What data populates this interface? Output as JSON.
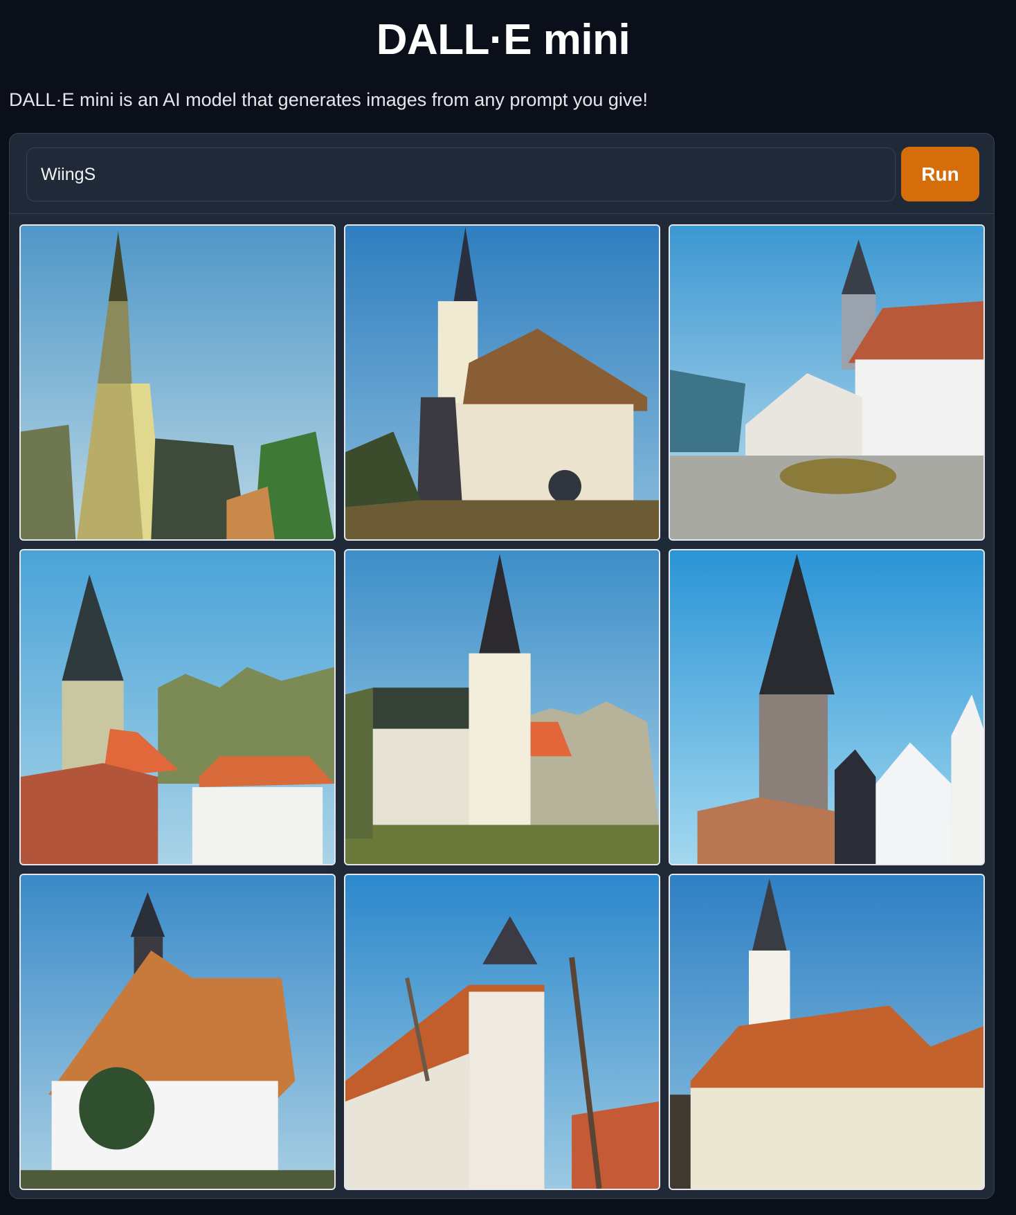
{
  "header": {
    "title": "DALL·E mini",
    "description": "DALL·E mini is an AI model that generates images from any prompt you give!"
  },
  "prompt": {
    "value": "WiingS"
  },
  "run_button": {
    "label": "Run"
  },
  "colors": {
    "background": "#0b0f19",
    "panel": "#1f2937",
    "accent": "#d56d0a"
  },
  "gallery": {
    "images": [
      {
        "name": "generated-image-1",
        "subject": "tall church spire with dark roof and trees"
      },
      {
        "name": "generated-image-2",
        "subject": "white tower church with brown tiled roofs"
      },
      {
        "name": "generated-image-3",
        "subject": "church tower with red roof and white building by road"
      },
      {
        "name": "generated-image-4",
        "subject": "church tower with trees and red roofed houses"
      },
      {
        "name": "generated-image-5",
        "subject": "white church tower with black spire"
      },
      {
        "name": "generated-image-6",
        "subject": "church with dark spire and white gables"
      },
      {
        "name": "generated-image-7",
        "subject": "white house with tower and orange roof"
      },
      {
        "name": "generated-image-8",
        "subject": "round white tower with orange roof and bare trees"
      },
      {
        "name": "generated-image-9",
        "subject": "church spire above orange roofed houses"
      }
    ]
  }
}
